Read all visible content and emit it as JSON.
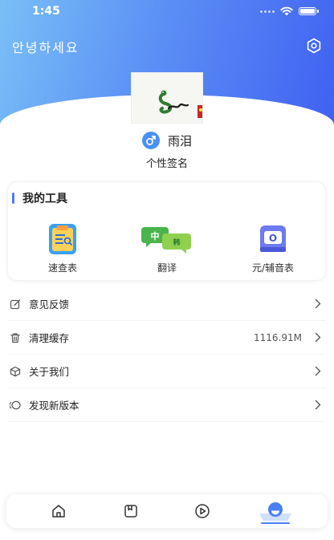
{
  "status_bar": {
    "time": "1:45"
  },
  "header": {
    "greeting": "안녕하세요"
  },
  "profile": {
    "name": "雨泪",
    "signature": "个性签名",
    "gender": "male"
  },
  "tools": {
    "title": "我的工具",
    "items": [
      {
        "label": "速查表",
        "icon": "quick-reference-icon"
      },
      {
        "label": "翻译",
        "icon": "translate-icon",
        "badge_left": "中",
        "badge_right": "韩"
      },
      {
        "label": "元/辅音表",
        "icon": "vowel-consonant-icon",
        "glyph": "O"
      }
    ]
  },
  "menu": {
    "items": [
      {
        "label": "意见反馈",
        "icon": "feedback-icon",
        "value": ""
      },
      {
        "label": "清理缓存",
        "icon": "trash-icon",
        "value": "1116.91M"
      },
      {
        "label": "关于我们",
        "icon": "cube-icon",
        "value": ""
      },
      {
        "label": "发现新版本",
        "icon": "version-icon",
        "value": ""
      }
    ]
  },
  "tabbar": {
    "tabs": [
      {
        "name": "home",
        "icon": "home-icon"
      },
      {
        "name": "notes",
        "icon": "notebook-icon"
      },
      {
        "name": "video",
        "icon": "play-icon"
      },
      {
        "name": "mine",
        "icon": "profile-icon",
        "active": true
      }
    ]
  },
  "colors": {
    "accent": "#4a7ef5",
    "hero_start": "#79bff7",
    "hero_end": "#3f5ff2",
    "translate_green": "#4bb44d",
    "vowel_purple": "#6c7bf0"
  }
}
